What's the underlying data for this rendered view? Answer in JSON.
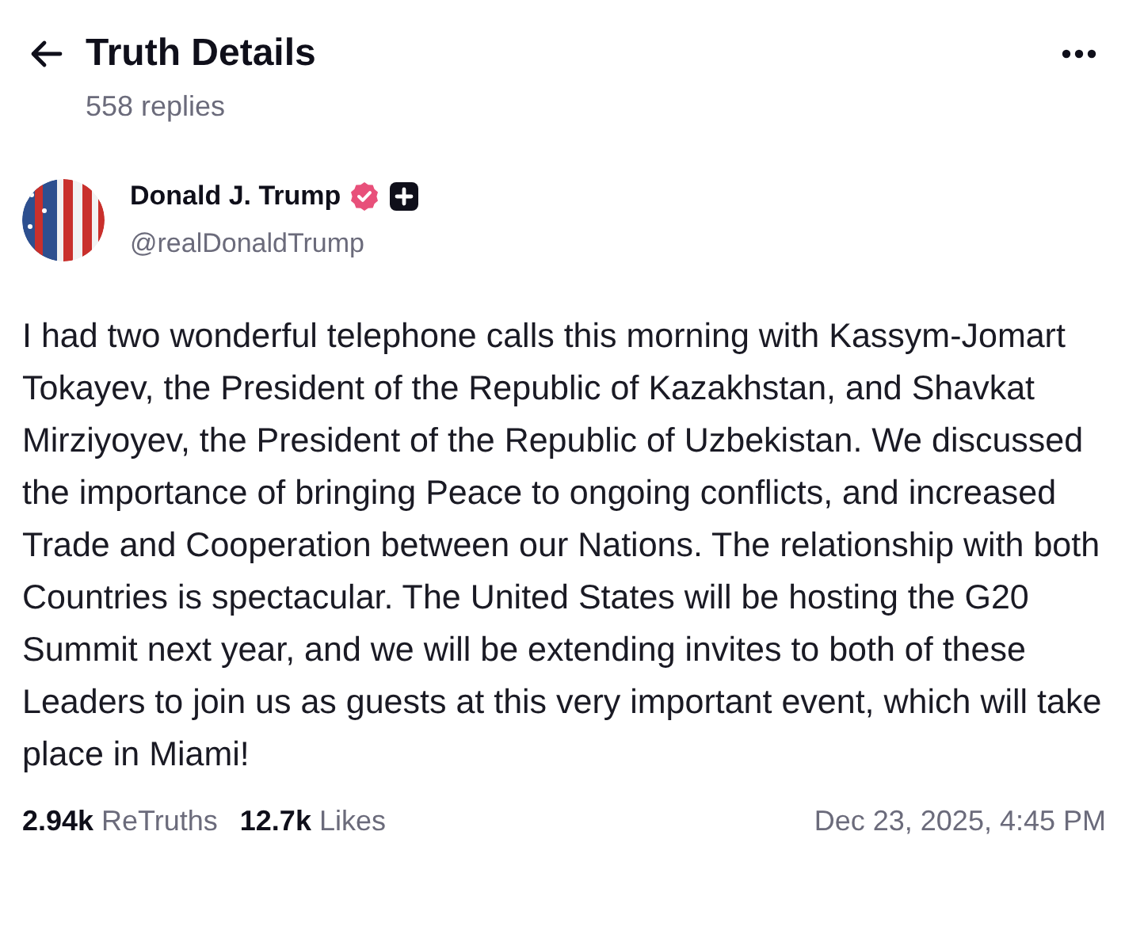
{
  "header": {
    "title": "Truth Details",
    "subtitle": "558 replies"
  },
  "author": {
    "name": "Donald J. Trump",
    "handle": "@realDonaldTrump",
    "verified": true
  },
  "post": {
    "text": "I had two wonderful telephone calls this morning with Kassym-Jomart Tokayev, the President of the Republic of Kazakhstan, and Shavkat Mirziyoyev, the President of the Republic of Uzbekistan. We discussed the importance of bringing Peace to ongoing conflicts, and increased Trade and Cooperation between our Nations. The relationship with both Countries is spectacular. The United States will be hosting the G20 Summit next year, and we will be extending invites to both of these Leaders to join us as guests at this very important event, which will take place in Miami!"
  },
  "stats": [
    {
      "count": "2.94k",
      "label": "ReTruths"
    },
    {
      "count": "12.7k",
      "label": "Likes"
    }
  ],
  "timestamp": "Dec 23, 2025, 4:45 PM"
}
